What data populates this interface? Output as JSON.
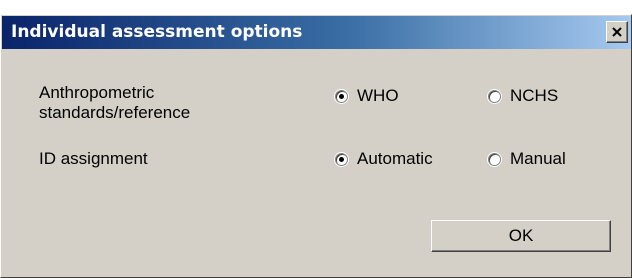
{
  "window": {
    "title": "Individual assessment options",
    "close_icon": "close-icon"
  },
  "options": {
    "anthro": {
      "label_line1": "Anthropometric",
      "label_line2": "standards/reference",
      "choices": [
        {
          "label": "WHO",
          "selected": true
        },
        {
          "label": "NCHS",
          "selected": false
        }
      ]
    },
    "id_assignment": {
      "label": "ID assignment",
      "choices": [
        {
          "label": "Automatic",
          "selected": true
        },
        {
          "label": "Manual",
          "selected": false
        }
      ]
    }
  },
  "buttons": {
    "ok_label": "OK"
  },
  "colors": {
    "face": "#d4d0c8",
    "title_start": "#0a246a",
    "title_end": "#a6caf0"
  }
}
